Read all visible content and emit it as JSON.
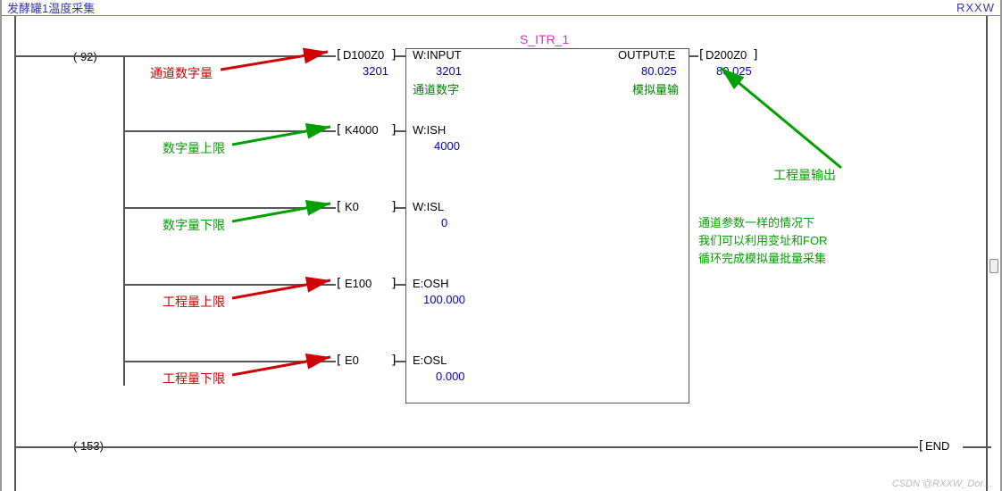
{
  "header": {
    "left": "发酵罐1温度采集",
    "right": "RXXW"
  },
  "rungs": {
    "num1": "(   92)",
    "num2": "(  153)"
  },
  "fb": {
    "title": "S_ITR_1"
  },
  "inputs": {
    "in1": {
      "addr": "D100Z0",
      "port": "W:INPUT",
      "val": "3201",
      "note": "通道数字",
      "label": "通道数字量"
    },
    "in2": {
      "addr": "K4000",
      "port": "W:ISH",
      "val": "4000",
      "label": "数字量上限"
    },
    "in3": {
      "addr": "K0",
      "port": "W:ISL",
      "val": "0",
      "label": "数字量下限"
    },
    "in4": {
      "addr": "E100",
      "port": "E:OSH",
      "val": "100.000",
      "label": "工程量上限"
    },
    "in5": {
      "addr": "E0",
      "port": "E:OSL",
      "val": "0.000",
      "label": "工程量下限"
    }
  },
  "output": {
    "port": "OUTPUT:E",
    "val": "80.025",
    "note": "模拟量输",
    "addr": "D200Z0",
    "addrval": "80.025",
    "label": "工程量输出"
  },
  "notes": {
    "line1": "通道参数一样的情况下",
    "line2": "我们可以利用变址和FOR",
    "line3": "循环完成模拟量批量采集"
  },
  "end": {
    "text": "END"
  },
  "watermark": "CSDN @RXXW_Dor…"
}
